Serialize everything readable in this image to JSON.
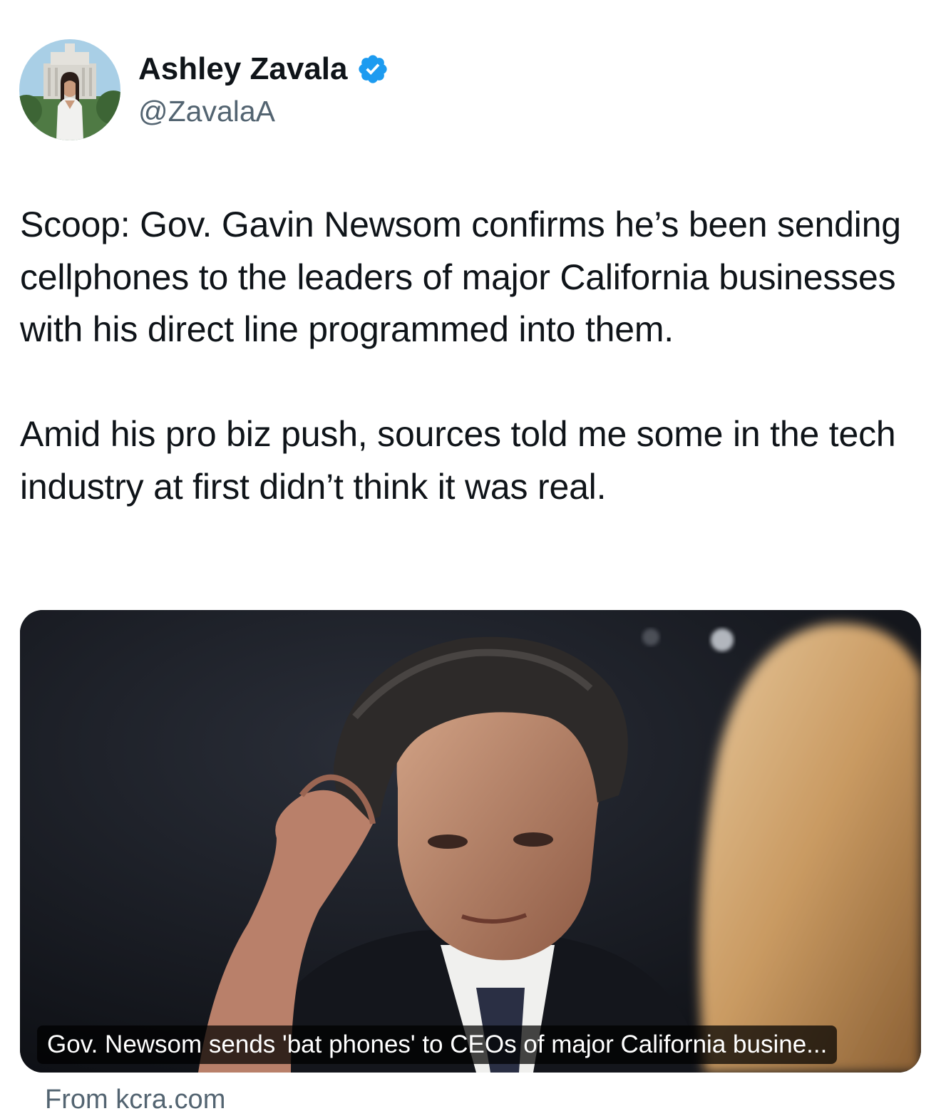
{
  "author": {
    "name": "Ashley Zavala",
    "handle": "@ZavalaA",
    "verified": true,
    "verified_icon": "verified-badge-icon",
    "verified_color": "#1d9bf0"
  },
  "tweet": {
    "paragraphs": [
      "Scoop: Gov. Gavin Newsom confirms he’s been sending cellphones to the leaders of major California businesses with his direct line programmed into them.",
      "Amid his pro biz push, sources told me some in the tech industry at first didn’t think it was real."
    ]
  },
  "link_card": {
    "caption": "Gov. Newsom sends 'bat phones' to CEOs of major California busine...",
    "source": "From kcra.com"
  },
  "colors": {
    "text": "#0f1419",
    "secondary": "#536471",
    "accent": "#1d9bf0"
  }
}
